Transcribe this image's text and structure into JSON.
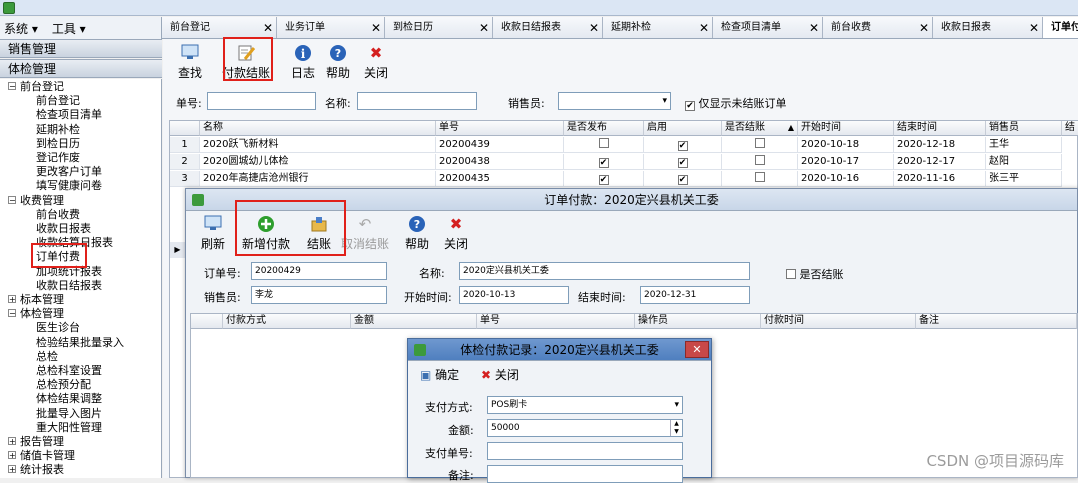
{
  "menubar": {
    "system": "系统 ▾",
    "tools": "工具 ▾"
  },
  "sidebar": {
    "sections": [
      "销售管理",
      "体检管理"
    ],
    "tree": [
      {
        "label": "前台登记",
        "level": 0,
        "toggle": "⊟"
      },
      {
        "label": "前台登记",
        "level": 1
      },
      {
        "label": "检查项目清单",
        "level": 1
      },
      {
        "label": "延期补检",
        "level": 1
      },
      {
        "label": "到检日历",
        "level": 1
      },
      {
        "label": "登记作废",
        "level": 1
      },
      {
        "label": "更改客户订单",
        "level": 1
      },
      {
        "label": "填写健康问卷",
        "level": 1
      },
      {
        "label": "收费管理",
        "level": 0,
        "toggle": "⊟"
      },
      {
        "label": "前台收费",
        "level": 1
      },
      {
        "label": "收款日报表",
        "level": 1
      },
      {
        "label": "收款结算日报表",
        "level": 1
      },
      {
        "label": "订单付费",
        "level": 1,
        "selected": true
      },
      {
        "label": "加项统计报表",
        "level": 1
      },
      {
        "label": "收款日结报表",
        "level": 1
      },
      {
        "label": "标本管理",
        "level": 0,
        "toggle": "⊞"
      },
      {
        "label": "体检管理",
        "level": 0,
        "toggle": "⊟"
      },
      {
        "label": "医生诊台",
        "level": 1
      },
      {
        "label": "检验结果批量录入",
        "level": 1
      },
      {
        "label": "总检",
        "level": 1
      },
      {
        "label": "总检科室设置",
        "level": 1
      },
      {
        "label": "总检预分配",
        "level": 1
      },
      {
        "label": "体检结果调整",
        "level": 1
      },
      {
        "label": "批量导入图片",
        "level": 1
      },
      {
        "label": "重大阳性管理",
        "level": 1
      },
      {
        "label": "报告管理",
        "level": 0,
        "toggle": "⊞"
      },
      {
        "label": "储值卡管理",
        "level": 0,
        "toggle": "⊞"
      },
      {
        "label": "统计报表",
        "level": 0,
        "toggle": "⊞"
      }
    ]
  },
  "tabs": [
    "前台登记",
    "业务订单",
    "到检日历",
    "收款日结报表",
    "延期补检",
    "检查项目清单",
    "前台收费",
    "收款日报表",
    "订单付"
  ],
  "toolbar": {
    "find": "查找",
    "settle": "付款结账",
    "log": "日志",
    "help": "帮助",
    "close": "关闭"
  },
  "filter": {
    "order_no_label": "单号:",
    "name_label": "名称:",
    "seller_label": "销售员:",
    "unsettled_label": "仅显示未结账订单",
    "unsettled_checked": true
  },
  "grid": {
    "headers": [
      "名称",
      "单号",
      "是否发布",
      "启用",
      "是否结账",
      "开始时间",
      "结束时间",
      "销售员",
      "结"
    ],
    "rows": [
      {
        "idx": "1",
        "name": "2020跃飞新材料",
        "no": "20200439",
        "published": false,
        "enabled": true,
        "settled": false,
        "start": "2020-10-18",
        "end": "2020-12-18",
        "seller": "王华"
      },
      {
        "idx": "2",
        "name": "2020圆城幼儿体检",
        "no": "20200438",
        "published": true,
        "enabled": true,
        "settled": false,
        "start": "2020-10-17",
        "end": "2020-12-17",
        "seller": "赵阳"
      },
      {
        "idx": "3",
        "name": "2020年高捷店沧州银行",
        "no": "20200435",
        "published": true,
        "enabled": true,
        "settled": false,
        "start": "2020-10-16",
        "end": "2020-11-16",
        "seller": "张三平"
      }
    ]
  },
  "order_dialog": {
    "title": "订单付款：2020定兴县机关工委",
    "toolbar": {
      "refresh": "刷新",
      "add_payment": "新增付款",
      "settle": "结账",
      "cancel_settle": "取消结账",
      "help": "帮助",
      "close": "关闭"
    },
    "order_no_label": "订单号:",
    "order_no": "20200429",
    "name_label": "名称:",
    "name": "2020定兴县机关工委",
    "settled_label": "是否结账",
    "seller_label": "销售员:",
    "seller": "李龙",
    "start_label": "开始时间:",
    "start": "2020-10-13",
    "end_label": "结束时间:",
    "end": "2020-12-31",
    "headers": [
      "付款方式",
      "金额",
      "单号",
      "操作员",
      "付款时间",
      "备注"
    ]
  },
  "payment_dialog": {
    "title": "体检付款记录：2020定兴县机关工委",
    "confirm": "确定",
    "close": "关闭",
    "method_label": "支付方式:",
    "method": "POS刷卡",
    "amount_label": "金额:",
    "amount": "50000",
    "pay_no_label": "支付单号:",
    "note_label": "备注:"
  },
  "watermark": "CSDN @项目源码库"
}
